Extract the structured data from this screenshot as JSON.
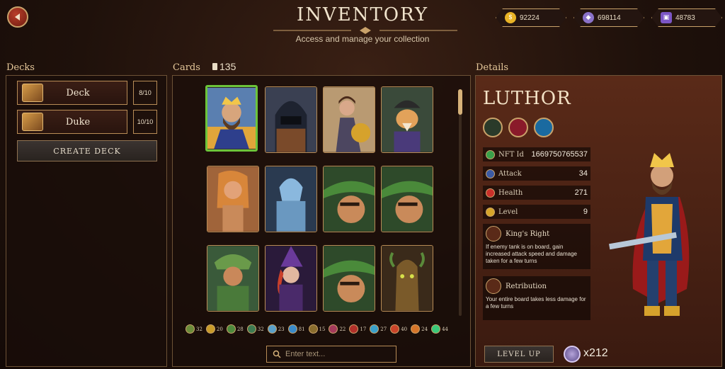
{
  "header": {
    "title": "INVENTORY",
    "subtitle": "Access and manage your collection"
  },
  "currencies": [
    {
      "value": "92224",
      "color": "#e8b326",
      "icon": "gold-coin-icon"
    },
    {
      "value": "698114",
      "color": "#8a72c9",
      "icon": "gem-icon"
    },
    {
      "value": "48783",
      "color": "#7c56c6",
      "icon": "token-icon"
    }
  ],
  "decks": {
    "title": "Decks",
    "items": [
      {
        "name": "Deck",
        "count": "8/10"
      },
      {
        "name": "Duke",
        "count": "10/10"
      }
    ],
    "create_label": "CREATE DECK"
  },
  "cards": {
    "title": "Cards",
    "count": "135",
    "filters": [
      {
        "count": "32",
        "color": "#6b8b3a"
      },
      {
        "count": "20",
        "color": "#c99b2a"
      },
      {
        "count": "28",
        "color": "#4e8a3d"
      },
      {
        "count": "32",
        "color": "#3e7b52"
      },
      {
        "count": "23",
        "color": "#5aa0c9"
      },
      {
        "count": "81",
        "color": "#3a8ac9"
      },
      {
        "count": "15",
        "color": "#8a6d2e"
      },
      {
        "count": "22",
        "color": "#a33a5a"
      },
      {
        "count": "17",
        "color": "#b0302a"
      },
      {
        "count": "27",
        "color": "#3aa0c9"
      },
      {
        "count": "40",
        "color": "#c9442a"
      },
      {
        "count": "24",
        "color": "#d6752a"
      },
      {
        "count": "44",
        "color": "#3ac97a"
      }
    ],
    "search_placeholder": "Enter text..."
  },
  "details": {
    "title": "Details",
    "hero_name": "LUTHOR",
    "stats": [
      {
        "label": "NFT Id",
        "value": "1669750765537",
        "icon": "nft-id-icon",
        "color": "#3aa04a"
      },
      {
        "label": "Attack",
        "value": "34",
        "icon": "sword-icon",
        "color": "#3b5aa3"
      },
      {
        "label": "Health",
        "value": "271",
        "icon": "heart-icon",
        "color": "#c9302a"
      },
      {
        "label": "Level",
        "value": "9",
        "icon": "level-icon",
        "color": "#d6a52a"
      }
    ],
    "skills": [
      {
        "name": "King's Right",
        "desc": "If enemy tank is on board, gain increased attack speed and damage taken for a few turns"
      },
      {
        "name": "Retribution",
        "desc": "Your entire board takes less damage for a few turns"
      }
    ],
    "level_up_label": "LEVEL UP",
    "token_count": "x212"
  }
}
